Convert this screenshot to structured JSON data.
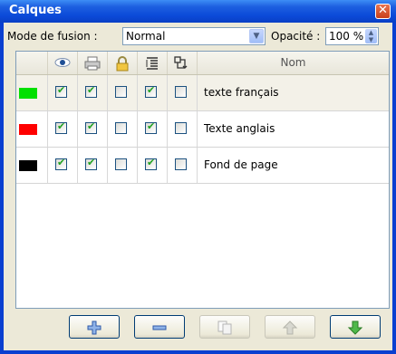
{
  "window": {
    "title": "Calques"
  },
  "blend": {
    "label": "Mode de fusion :",
    "value": "Normal"
  },
  "opacity": {
    "label": "Opacité :",
    "value": "100 %"
  },
  "table": {
    "header_name": "Nom",
    "rows": [
      {
        "color": "#00e000",
        "visible": true,
        "printable": true,
        "locked": false,
        "flag4": true,
        "flag5": false,
        "name": "texte français",
        "selected": true
      },
      {
        "color": "#ff0000",
        "visible": true,
        "printable": true,
        "locked": false,
        "flag4": true,
        "flag5": false,
        "name": "Texte anglais",
        "selected": false
      },
      {
        "color": "#000000",
        "visible": true,
        "printable": true,
        "locked": false,
        "flag4": true,
        "flag5": false,
        "name": "Fond de page",
        "selected": false
      }
    ]
  },
  "colors": {
    "titlebar": "#0a3fd0",
    "check": "#21a121"
  }
}
